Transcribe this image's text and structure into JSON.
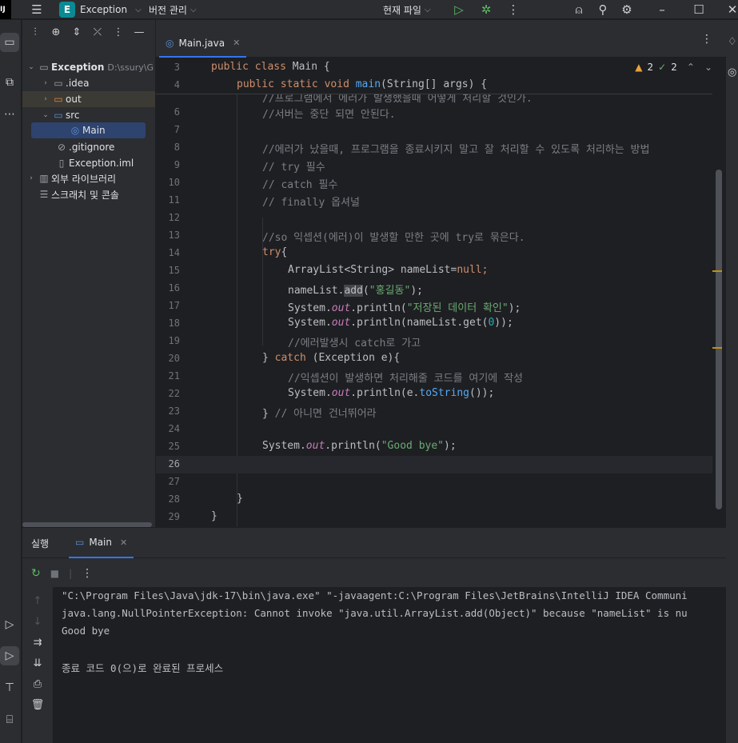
{
  "titlebar": {
    "project_initial": "E",
    "project_name": "Exception",
    "vcs_label": "버전 관리",
    "run_config": "현재 파일"
  },
  "project_panel": {
    "tree": [
      {
        "name": "Exception",
        "path": "D:\\ssury\\G"
      },
      {
        "name": ".idea"
      },
      {
        "name": "out"
      },
      {
        "name": "src"
      },
      {
        "name": "Main"
      },
      {
        "name": ".gitignore"
      },
      {
        "name": "Exception.iml"
      },
      {
        "name": "외부 라이브러리"
      },
      {
        "name": "스크래치 및 콘솔"
      }
    ]
  },
  "editor": {
    "tab_label": "Main.java",
    "inspections": {
      "warnings": "2",
      "weak_warnings": "2"
    },
    "line_numbers": [
      "3",
      "4",
      "6",
      "7",
      "8",
      "9",
      "10",
      "11",
      "12",
      "13",
      "14",
      "15",
      "16",
      "17",
      "18",
      "19",
      "20",
      "21",
      "22",
      "23",
      "24",
      "25",
      "26",
      "27",
      "28",
      "29"
    ],
    "sticky_lines": {
      "l3_kw1": "public",
      "l3_kw2": "class",
      "l3_name": "Main {",
      "l4_kw1": "public",
      "l4_kw2": "static",
      "l4_kw3": "void",
      "l4_fn": "main",
      "l4_rest": "(String[] args) {"
    },
    "code": {
      "l5_partial": "//프로그램에서 에러가 발생했을때 어떻게 처리할 것인가.",
      "l6": "//서버는 중단 되면 안된다.",
      "l8": "//에러가 났을때, 프로그램을 종료시키지 말고 잘 처리할 수 있도록 처리하는 방법",
      "l9": "// try 필수",
      "l10": "// catch 필수",
      "l11": "// finally 옵셔널",
      "l13": "//so 익셉션(에러)이 발생할 만한 곳에 try로 묶은다.",
      "l14_kw": "try",
      "l14_rest": "{",
      "l15_a": "ArrayList<String> nameList=",
      "l15_kw": "null",
      "l15_b": ";",
      "l16_a": "nameList.",
      "l16_hl": "add",
      "l16_b": "(",
      "l16_str": "\"홍길동\"",
      "l16_c": ");",
      "l17_a": "System.",
      "l17_st": "out",
      "l17_b": ".println(",
      "l17_str": "\"저장된 데이터 확인\"",
      "l17_c": ");",
      "l18_a": "System.",
      "l18_st": "out",
      "l18_b": ".println(nameList.get(",
      "l18_num": "0",
      "l18_c": "));",
      "l19": "//에러발생시 catch로 가고",
      "l20_a": "} ",
      "l20_kw": "catch",
      "l20_b": " (Exception e){",
      "l21": "//익셉션이 발생하면 처리해줄 코드를 여기에 작성",
      "l22_a": "System.",
      "l22_st": "out",
      "l22_b": ".println(e.",
      "l22_fn": "toString",
      "l22_c": "());",
      "l23_a": "} ",
      "l23_cm": "// 아니면 건너뛰어라",
      "l25_a": "System.",
      "l25_st": "out",
      "l25_b": ".println(",
      "l25_str": "\"Good bye\"",
      "l25_c": ");",
      "l28": "}",
      "l29": "}"
    }
  },
  "run_panel": {
    "label": "실행",
    "tab_label": "Main",
    "console": {
      "cmd": "\"C:\\Program Files\\Java\\jdk-17\\bin\\java.exe\" \"-javaagent:C:\\Program Files\\JetBrains\\IntelliJ IDEA Communi",
      "error": "java.lang.NullPointerException: Cannot invoke \"java.util.ArrayList.add(Object)\" because \"nameList\" is nu",
      "output": "Good bye",
      "exit": "종료 코드 0(으)로 완료된 프로세스"
    }
  },
  "colors": {
    "accent": "#3574f0",
    "keyword": "#cf8e6d",
    "string": "#6aab73",
    "comment": "#7a7e85",
    "function": "#56a8f5",
    "warning": "#e8a33d",
    "run_green": "#5fb865"
  },
  "icons": {
    "menu": "hamburger-icon",
    "run": "play-icon",
    "debug": "bug-icon",
    "search": "search-icon",
    "settings": "gear-icon"
  }
}
